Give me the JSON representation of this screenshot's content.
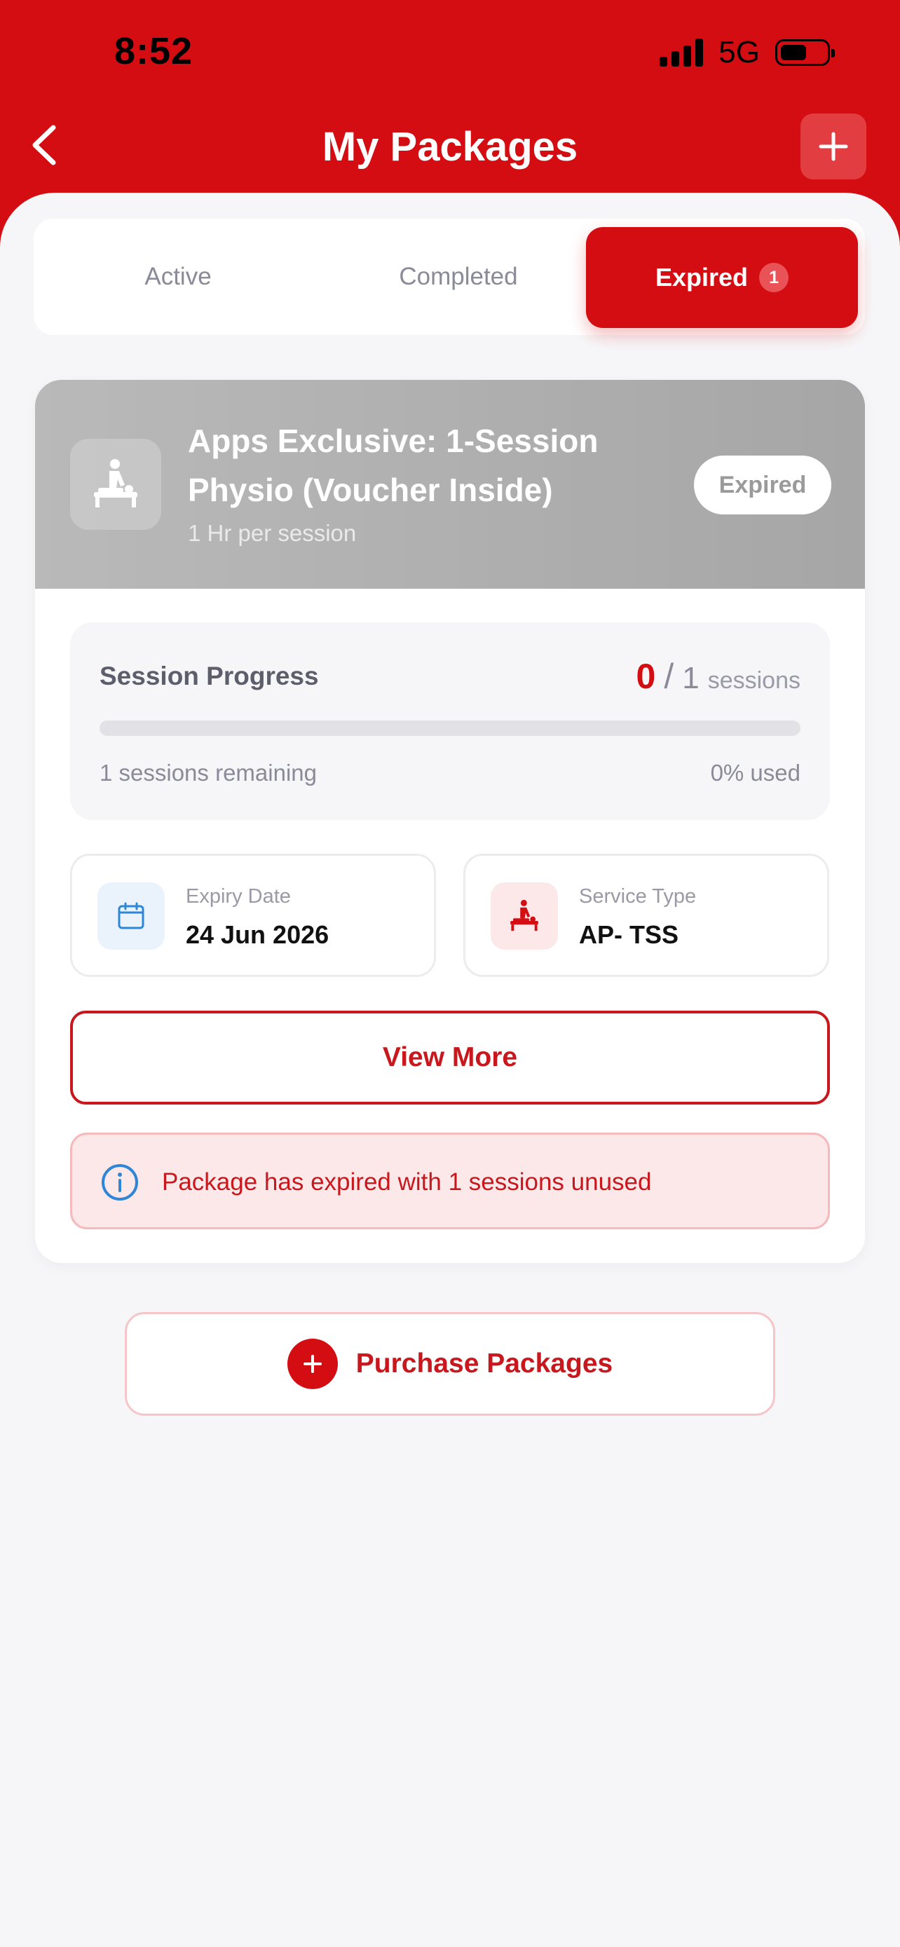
{
  "status_bar": {
    "time": "8:52",
    "network": "5G"
  },
  "header": {
    "title": "My Packages"
  },
  "tabs": [
    {
      "label": "Active"
    },
    {
      "label": "Completed"
    },
    {
      "label": "Expired",
      "badge": "1"
    }
  ],
  "package": {
    "title": "Apps Exclusive: 1-Session Physio (Voucher Inside)",
    "subtitle": "1 Hr per session",
    "status": "Expired",
    "progress": {
      "label": "Session Progress",
      "used": "0",
      "total": "1",
      "unit": "sessions",
      "remaining_text": "1 sessions remaining",
      "percent_text": "0% used",
      "fraction_used": 0
    },
    "expiry": {
      "label": "Expiry Date",
      "value": "24 Jun 2026"
    },
    "service": {
      "label": "Service Type",
      "value": "AP- TSS"
    },
    "view_more_label": "View More",
    "notice": "Package has expired with 1 sessions unused"
  },
  "purchase_label": "Purchase Packages",
  "colors": {
    "brand": "#d30d12",
    "expired_header": "#aaaaaa",
    "notice_bg": "#fde8e9"
  }
}
